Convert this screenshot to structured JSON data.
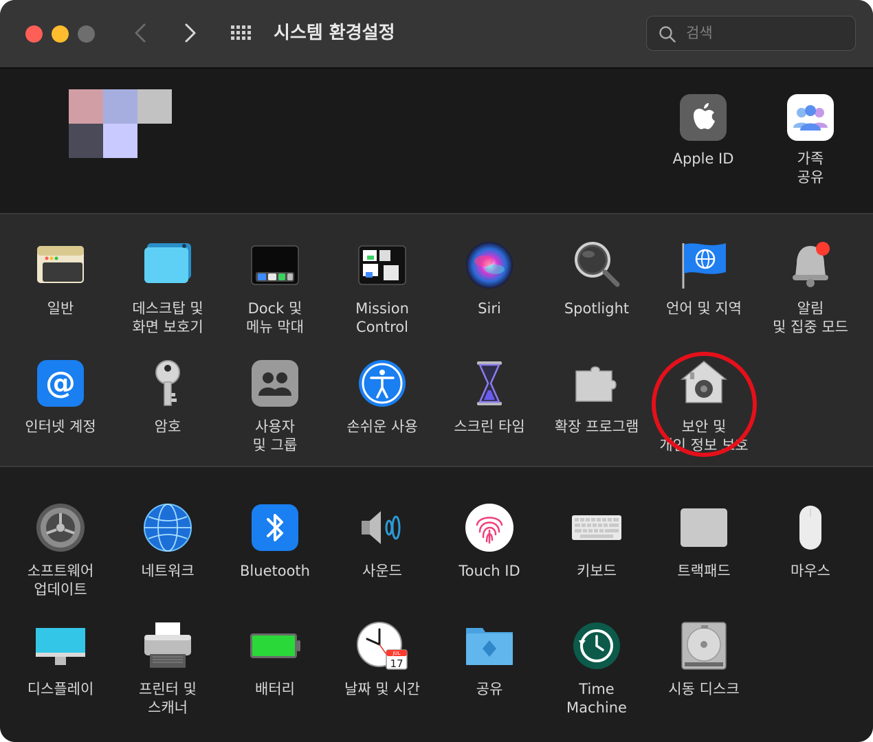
{
  "window": {
    "title": "시스템 환경설정",
    "search": {
      "placeholder": "검색",
      "icon": "search-icon"
    }
  },
  "traffic_lights": {
    "close": "#ff5f57",
    "minimize": "#febc2e",
    "zoom": "#6e6e6e"
  },
  "account": {
    "avatar_pixels": [
      "#d19ea5",
      "#a6aee0",
      "#c2c2c2",
      "#4a4a58",
      "#c9caff"
    ],
    "items": [
      {
        "label": "Apple ID",
        "icon": "apple-id-icon"
      },
      {
        "label": "가족\n공유",
        "icon": "family-sharing-icon"
      }
    ]
  },
  "panes_row1": [
    {
      "label": "일반",
      "icon": "general-icon"
    },
    {
      "label": "데스크탑 및\n화면 보호기",
      "icon": "desktop-screensaver-icon"
    },
    {
      "label": "Dock 및\n메뉴 막대",
      "icon": "dock-icon"
    },
    {
      "label": "Mission\nControl",
      "icon": "mission-control-icon"
    },
    {
      "label": "Siri",
      "icon": "siri-icon"
    },
    {
      "label": "Spotlight",
      "icon": "spotlight-icon"
    },
    {
      "label": "언어 및 지역",
      "icon": "language-region-icon"
    },
    {
      "label": "알림\n및 집중 모드",
      "icon": "notifications-icon"
    }
  ],
  "panes_row2": [
    {
      "label": "인터넷 계정",
      "icon": "internet-accounts-icon"
    },
    {
      "label": "암호",
      "icon": "passwords-icon"
    },
    {
      "label": "사용자\n및 그룹",
      "icon": "users-groups-icon"
    },
    {
      "label": "손쉬운 사용",
      "icon": "accessibility-icon"
    },
    {
      "label": "스크린 타임",
      "icon": "screen-time-icon"
    },
    {
      "label": "확장 프로그램",
      "icon": "extensions-icon"
    },
    {
      "label": "보안 및\n개인 정보 보호",
      "icon": "security-privacy-icon"
    }
  ],
  "panes_row3": [
    {
      "label": "소프트웨어\n업데이트",
      "icon": "software-update-icon"
    },
    {
      "label": "네트워크",
      "icon": "network-icon"
    },
    {
      "label": "Bluetooth",
      "icon": "bluetooth-icon"
    },
    {
      "label": "사운드",
      "icon": "sound-icon"
    },
    {
      "label": "Touch ID",
      "icon": "touch-id-icon"
    },
    {
      "label": "키보드",
      "icon": "keyboard-icon"
    },
    {
      "label": "트랙패드",
      "icon": "trackpad-icon"
    },
    {
      "label": "마우스",
      "icon": "mouse-icon"
    }
  ],
  "panes_row4": [
    {
      "label": "디스플레이",
      "icon": "displays-icon"
    },
    {
      "label": "프린터 및\n스캐너",
      "icon": "printers-scanners-icon"
    },
    {
      "label": "배터리",
      "icon": "battery-icon"
    },
    {
      "label": "날짜 및 시간",
      "icon": "date-time-icon",
      "calendar_month": "JUL",
      "calendar_day": "17"
    },
    {
      "label": "공유",
      "icon": "sharing-icon"
    },
    {
      "label": "Time\nMachine",
      "icon": "time-machine-icon"
    },
    {
      "label": "시동 디스크",
      "icon": "startup-disk-icon"
    }
  ],
  "highlight": {
    "target": "보안 및 개인 정보 보호",
    "color": "#e5101a"
  }
}
